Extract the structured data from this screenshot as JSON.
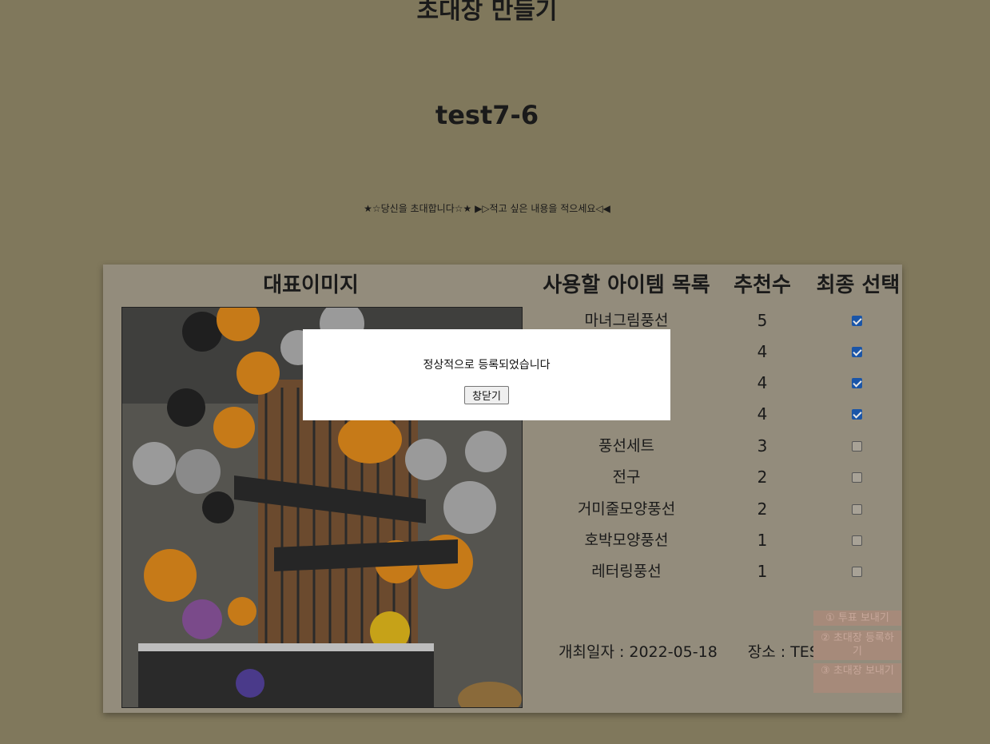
{
  "header": {
    "page_title": "초대장 만들기",
    "event_title": "test7-6",
    "invite_message": "★☆당신을 초대합니다☆★ ▶▷적고 싶은 내용을 적으세요◁◀"
  },
  "table": {
    "headers": {
      "image": "대표이미지",
      "items": "사용할 아이템 목록",
      "votes": "추천수",
      "final": "최종 선택"
    },
    "rows": [
      {
        "name": "마녀그림풍선",
        "votes": "5",
        "checked": true
      },
      {
        "name": "",
        "votes": "4",
        "checked": true
      },
      {
        "name": "",
        "votes": "4",
        "checked": true
      },
      {
        "name": "",
        "votes": "4",
        "checked": true
      },
      {
        "name": "풍선세트",
        "votes": "3",
        "checked": false
      },
      {
        "name": "전구",
        "votes": "2",
        "checked": false
      },
      {
        "name": "거미줄모양풍선",
        "votes": "2",
        "checked": false
      },
      {
        "name": "호박모양풍선",
        "votes": "1",
        "checked": false
      },
      {
        "name": "레터링풍선",
        "votes": "1",
        "checked": false
      }
    ]
  },
  "event_info": {
    "date_label": "개최일자 :",
    "date_value": "2022-05-18",
    "place_label": "장소 :",
    "place_value": "TEST7-6"
  },
  "actions": {
    "vote": "① 투표 보내기",
    "register": "② 초대장 등록하기",
    "send": "③ 초대장 보내기"
  },
  "modal": {
    "message": "정상적으로 등록되었습니다",
    "close_label": "창닫기"
  },
  "colors": {
    "overlay_background": "#80785c",
    "card_background": "#938c7c",
    "checkbox_checked": "#1a55a8",
    "action_button": "#a68a7a"
  }
}
